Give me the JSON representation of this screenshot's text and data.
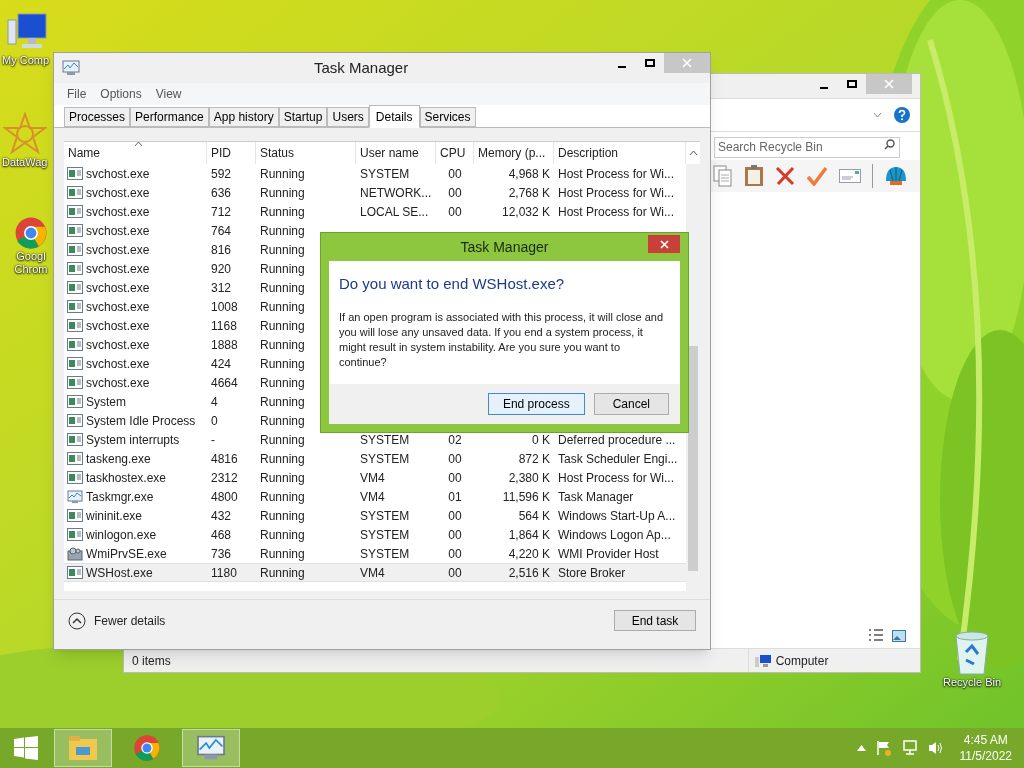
{
  "desktop_icons": [
    {
      "kind": "computer",
      "lines": [
        "My Comp"
      ]
    },
    {
      "kind": "datawag",
      "lines": [
        "DataWag"
      ]
    },
    {
      "kind": "chrome",
      "lines": [
        "Googl",
        "Chrom"
      ]
    },
    {
      "kind": "recycle",
      "lines": [
        "Recycle Bin"
      ]
    }
  ],
  "explorer": {
    "search": {
      "placeholder": "Search Recycle Bin"
    },
    "status": "0 items",
    "location": "Computer"
  },
  "task_manager": {
    "title": "Task Manager",
    "menu": [
      "File",
      "Options",
      "View"
    ],
    "tabs": [
      {
        "label": "Processes",
        "selected": false
      },
      {
        "label": "Performance",
        "selected": false
      },
      {
        "label": "App history",
        "selected": false
      },
      {
        "label": "Startup",
        "selected": false
      },
      {
        "label": "Users",
        "selected": false
      },
      {
        "label": "Details",
        "selected": true
      },
      {
        "label": "Services",
        "selected": false
      }
    ],
    "columns": [
      {
        "label": "Name",
        "sorted": true
      },
      {
        "label": "PID",
        "sorted": false
      },
      {
        "label": "Status",
        "sorted": false
      },
      {
        "label": "User name",
        "sorted": false
      },
      {
        "label": "CPU",
        "sorted": false
      },
      {
        "label": "Memory (p...",
        "sorted": false
      },
      {
        "label": "Description",
        "sorted": false
      }
    ],
    "rows": [
      {
        "kind": "service",
        "name": "svchost.exe",
        "pid": "592",
        "status": "Running",
        "user": "SYSTEM",
        "cpu": "00",
        "memory": "4,968 K",
        "description": "Host Process for Wi...",
        "selected": false
      },
      {
        "kind": "service",
        "name": "svchost.exe",
        "pid": "636",
        "status": "Running",
        "user": "NETWORK...",
        "cpu": "00",
        "memory": "2,768 K",
        "description": "Host Process for Wi...",
        "selected": false
      },
      {
        "kind": "service",
        "name": "svchost.exe",
        "pid": "712",
        "status": "Running",
        "user": "LOCAL SE...",
        "cpu": "00",
        "memory": "12,032 K",
        "description": "Host Process for Wi...",
        "selected": false
      },
      {
        "kind": "service",
        "name": "svchost.exe",
        "pid": "764",
        "status": "Running",
        "selected": false
      },
      {
        "kind": "service",
        "name": "svchost.exe",
        "pid": "816",
        "status": "Running",
        "selected": false
      },
      {
        "kind": "service",
        "name": "svchost.exe",
        "pid": "920",
        "status": "Running",
        "selected": false
      },
      {
        "kind": "service",
        "name": "svchost.exe",
        "pid": "312",
        "status": "Running",
        "selected": false
      },
      {
        "kind": "service",
        "name": "svchost.exe",
        "pid": "1008",
        "status": "Running",
        "selected": false
      },
      {
        "kind": "service",
        "name": "svchost.exe",
        "pid": "1168",
        "status": "Running",
        "selected": false
      },
      {
        "kind": "service",
        "name": "svchost.exe",
        "pid": "1888",
        "status": "Running",
        "selected": false
      },
      {
        "kind": "service",
        "name": "svchost.exe",
        "pid": "424",
        "status": "Running",
        "selected": false
      },
      {
        "kind": "service",
        "name": "svchost.exe",
        "pid": "4664",
        "status": "Running",
        "selected": false
      },
      {
        "kind": "service",
        "name": "System",
        "pid": "4",
        "status": "Running",
        "selected": false
      },
      {
        "kind": "service",
        "name": "System Idle Process",
        "pid": "0",
        "status": "Running",
        "selected": false
      },
      {
        "kind": "service",
        "name": "System interrupts",
        "pid": "-",
        "status": "Running",
        "user": "SYSTEM",
        "cpu": "02",
        "memory": "0 K",
        "description": "Deferred procedure ...",
        "selected": false
      },
      {
        "kind": "service",
        "name": "taskeng.exe",
        "pid": "4816",
        "status": "Running",
        "user": "SYSTEM",
        "cpu": "00",
        "memory": "872 K",
        "description": "Task Scheduler Engi...",
        "selected": false
      },
      {
        "kind": "service",
        "name": "taskhostex.exe",
        "pid": "2312",
        "status": "Running",
        "user": "VM4",
        "cpu": "00",
        "memory": "2,380 K",
        "description": "Host Process for Wi...",
        "selected": false
      },
      {
        "kind": "monitor",
        "name": "Taskmgr.exe",
        "pid": "4800",
        "status": "Running",
        "user": "VM4",
        "cpu": "01",
        "memory": "11,596 K",
        "description": "Task Manager",
        "selected": false
      },
      {
        "kind": "service",
        "name": "wininit.exe",
        "pid": "432",
        "status": "Running",
        "user": "SYSTEM",
        "cpu": "00",
        "memory": "564 K",
        "description": "Windows Start-Up A...",
        "selected": false
      },
      {
        "kind": "service",
        "name": "winlogon.exe",
        "pid": "468",
        "status": "Running",
        "user": "SYSTEM",
        "cpu": "00",
        "memory": "1,864 K",
        "description": "Windows Logon Ap...",
        "selected": false
      },
      {
        "kind": "gears",
        "name": "WmiPrvSE.exe",
        "pid": "736",
        "status": "Running",
        "user": "SYSTEM",
        "cpu": "00",
        "memory": "4,220 K",
        "description": "WMI Provider Host",
        "selected": false
      },
      {
        "kind": "service",
        "name": "WSHost.exe",
        "pid": "1180",
        "status": "Running",
        "user": "VM4",
        "cpu": "00",
        "memory": "2,516 K",
        "description": "Store Broker",
        "selected": true
      }
    ],
    "fewer_details": "Fewer details",
    "end_task": "End task"
  },
  "dialog": {
    "title": "Task Manager",
    "heading": "Do you want to end WSHost.exe?",
    "message": "If an open program is associated with this process, it will close and you will lose any unsaved data. If you end a system process, it might result in system instability. Are you sure you want to continue?",
    "buttons": [
      {
        "label": "End process",
        "selected": true
      },
      {
        "label": "Cancel",
        "selected": false
      }
    ]
  },
  "taskbar": {
    "apps": [
      {
        "kind": "explorer",
        "active": true
      },
      {
        "kind": "chrome",
        "active": false
      },
      {
        "kind": "taskmgr",
        "active": true
      }
    ],
    "time": "4:45 AM",
    "date": "11/5/2022"
  }
}
